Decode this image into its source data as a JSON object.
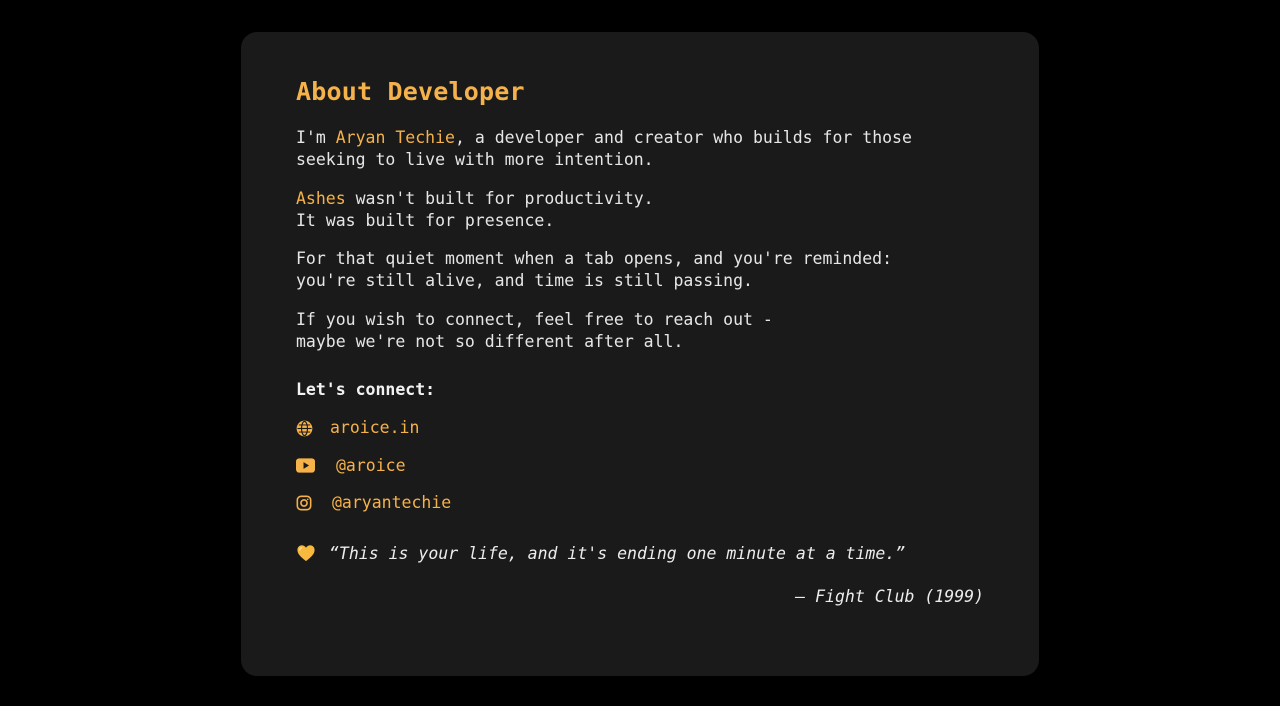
{
  "about": {
    "title": "About Developer",
    "p1": {
      "before": "I'm ",
      "name": "Aryan Techie",
      "after": ", a developer and creator who builds for those",
      "line2": "seeking to live with more intention."
    },
    "p2": {
      "app": "Ashes",
      "after": " wasn't built for productivity.",
      "line2": "It was built for presence."
    },
    "p3": {
      "line1": "For that quiet moment when a tab opens, and you're reminded:",
      "line2": "you're still alive, and time is still passing."
    },
    "p4": {
      "line1": "If you wish to connect, feel free to reach out -",
      "line2": "maybe we're not so different after all."
    },
    "connect_title": "Let's connect:",
    "links": [
      {
        "icon": "globe-icon",
        "label": "aroice.in"
      },
      {
        "icon": "youtube-icon",
        "label": "@aroice"
      },
      {
        "icon": "instagram-icon",
        "label": "@aryantechie"
      }
    ],
    "quote": "“This is your life, and it's ending one minute at a time.”",
    "attribution": "— Fight Club (1999)"
  },
  "colors": {
    "background": "#000000",
    "card": "#1a1a1a",
    "accent": "#f6b24a",
    "text": "#e6e6e6"
  }
}
